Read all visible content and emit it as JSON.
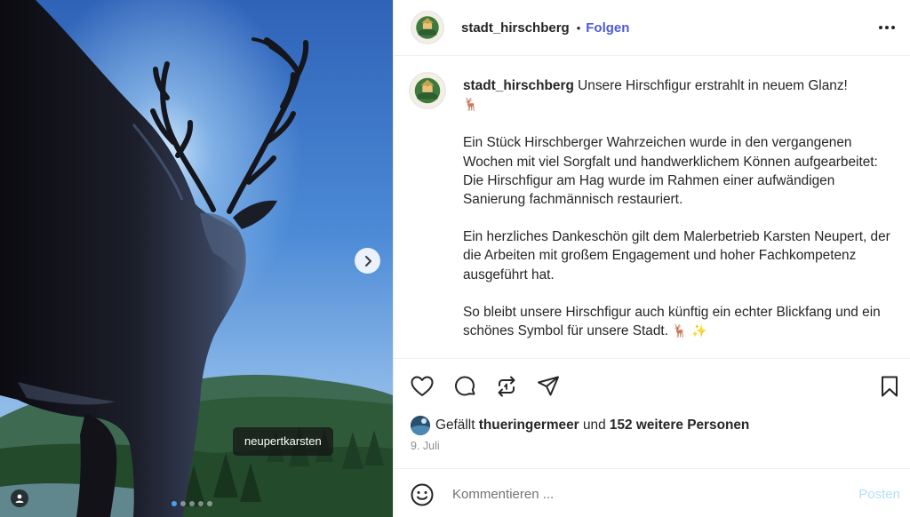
{
  "post": {
    "media": {
      "tag_label": "neupertkarsten",
      "slide_count": 5,
      "active_slide": 1,
      "next_icon": "chevron-right-icon",
      "user_tag_icon": "person-icon"
    },
    "header": {
      "username": "stadt_hirschberg",
      "separator": "•",
      "follow_label": "Folgen",
      "more_icon": "more-horizontal-icon"
    },
    "caption": {
      "username": "stadt_hirschberg",
      "paragraphs": [
        "Unsere Hirschfigur erstrahlt in neuem Glanz!",
        "Ein Stück Hirschberger Wahrzeichen wurde in den vergangenen Wochen mit viel Sorgfalt und handwerklichem Können aufgearbeitet: Die Hirschfigur am Hag wurde im Rahmen einer aufwändigen Sanierung fachmännisch restauriert.",
        "Ein herzliches Dankeschön gilt dem Malerbetrieb Karsten Neupert, der die Arbeiten mit großem Engagement und hoher Fachkompetenz ausgeführt hat.",
        "So bleibt unsere Hirschfigur auch künftig ein echter Blickfang und ein schönes Symbol für unsere Stadt."
      ],
      "emoji_1": "🦌",
      "emoji_2": "🦌 ✨"
    },
    "actions": {
      "like_icon": "heart-icon",
      "comment_icon": "comment-icon",
      "repost_icon": "repost-icon",
      "share_icon": "send-icon",
      "save_icon": "bookmark-icon"
    },
    "likes": {
      "prefix": "Gefällt",
      "first_liker": "thueringermeer",
      "middle": "und",
      "others": "152 weitere Personen"
    },
    "date": "9. Juli",
    "comment": {
      "placeholder": "Kommentieren ...",
      "post_label": "Posten",
      "emoji_icon": "smiley-icon"
    },
    "colors": {
      "follow": "#4f5bd5",
      "post_button_disabled": "#b2dffc",
      "text": "#262626",
      "muted": "#8e8e8e",
      "slide_dot_active": "#4a9ef0"
    }
  }
}
